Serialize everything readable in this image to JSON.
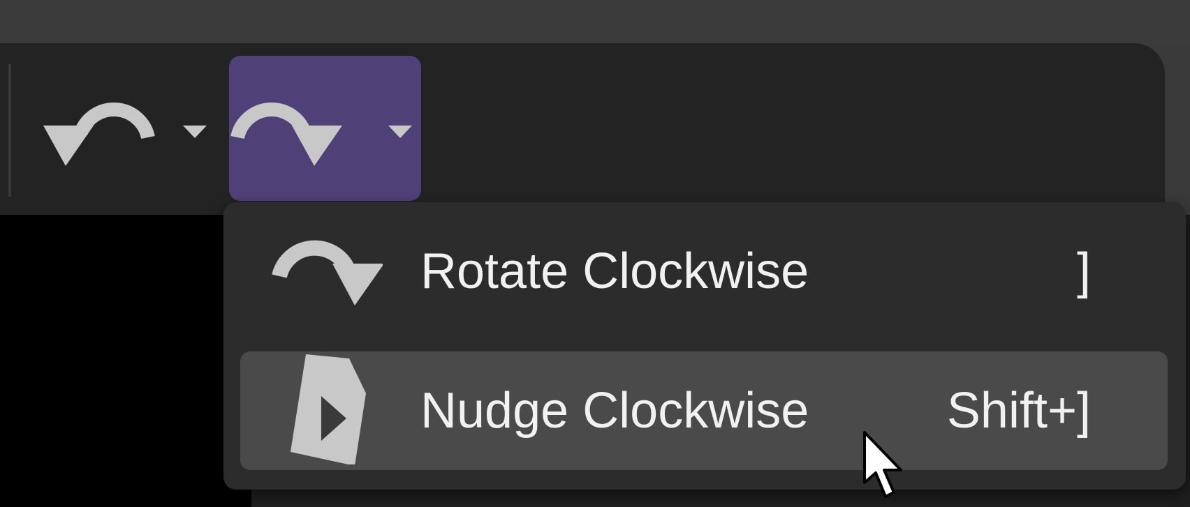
{
  "toolbar": {
    "rotate_ccw_icon": "rotate-counterclockwise-icon",
    "rotate_cw_icon": "rotate-clockwise-icon",
    "dropdown_icon": "chevron-down-icon",
    "active_color": "#4f4177"
  },
  "menu": {
    "items": [
      {
        "label": "Rotate Clockwise",
        "shortcut": "]",
        "icon": "rotate-clockwise-icon"
      },
      {
        "label": "Nudge Clockwise",
        "shortcut": "Shift+]",
        "icon": "nudge-clockwise-icon"
      }
    ],
    "hover_color": "#4a4a4a"
  },
  "colors": {
    "background": "#232323",
    "icon": "#c8c8c8",
    "text": "#f1f1f1"
  }
}
